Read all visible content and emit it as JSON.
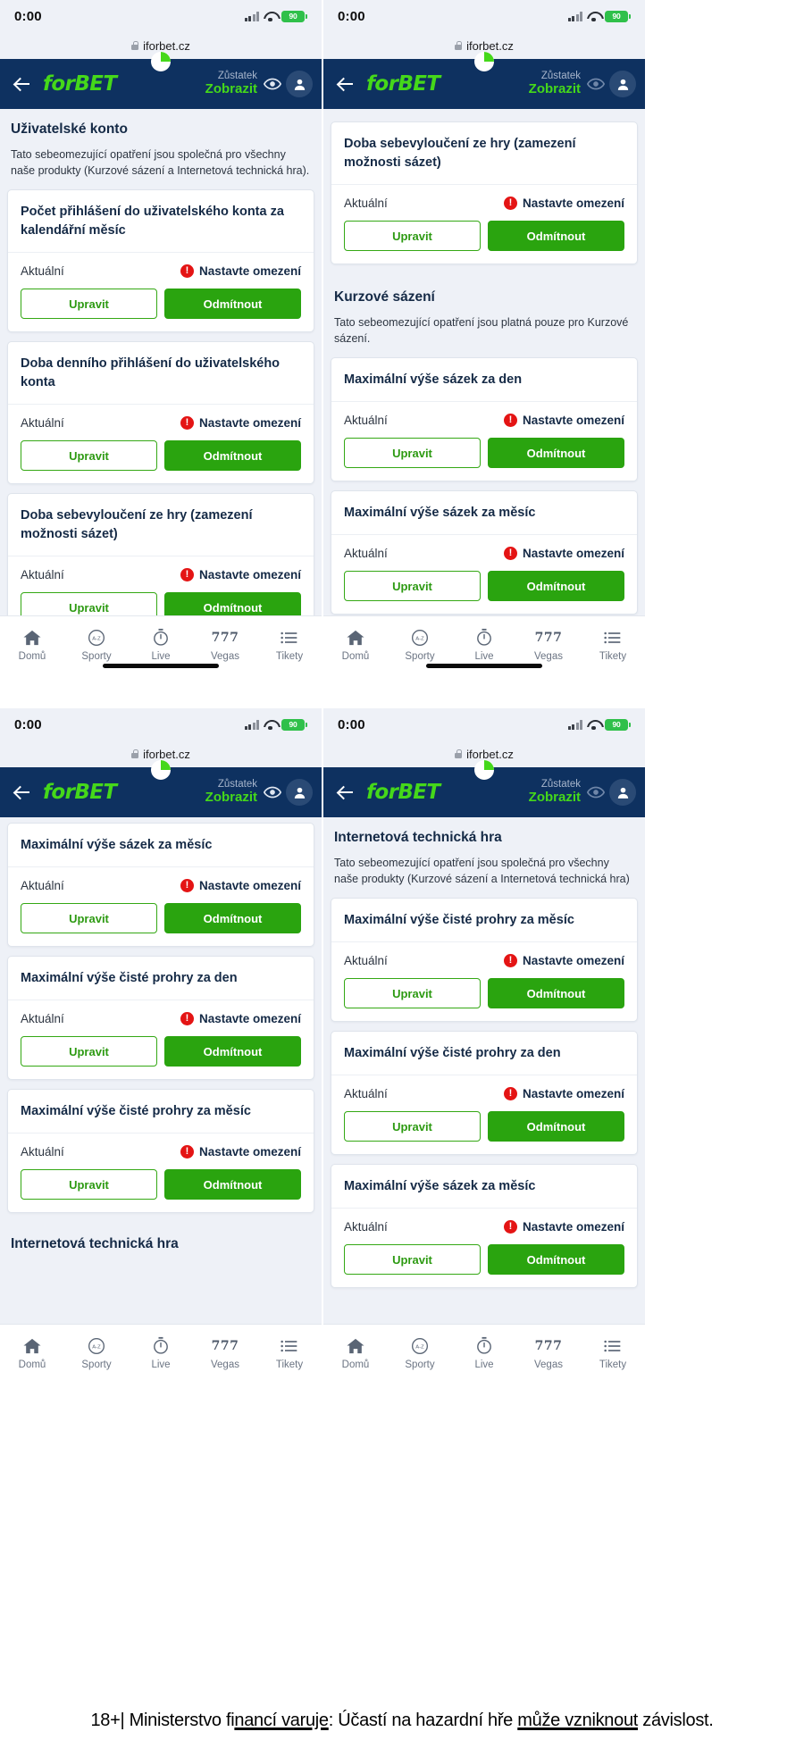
{
  "status_bar": {
    "time": "0:00",
    "battery": "90",
    "signal_icon": "cellular-bars-icon",
    "wifi_icon": "wifi-icon"
  },
  "browser": {
    "lock_icon": "lock-icon",
    "url": "iforbet.cz"
  },
  "appbar": {
    "back_icon": "back-arrow-icon",
    "logo": "forBET",
    "balance_label": "Zůstatek",
    "balance_value": "Zobrazit",
    "eye_icon": "eye-icon",
    "avatar_icon": "user-avatar-icon"
  },
  "labels": {
    "current": "Aktuální",
    "set_limit": "Nastavte omezení",
    "edit": "Upravit",
    "decline": "Odmítnout",
    "warning_icon": "warning-exclamation-icon"
  },
  "sections": {
    "user_account": {
      "title": "Uživatelské konto",
      "desc": "Tato sebeomezující opatření jsou společná pro všechny naše produkty (Kurzové sázení a Internetová technická hra)."
    },
    "odds_betting": {
      "title": "Kurzové sázení",
      "desc": "Tato sebeomezující opatření jsou platná pouze pro Kurzové sázení."
    },
    "tech_game": {
      "title": "Internetová technická hra",
      "desc": "Tato sebeomezující opatření jsou společná pro všechny naše produkty (Kurzové sázení a Internetová technická hra)"
    }
  },
  "limits": {
    "login_count_month": "Počet přihlášení do uživatelského konta za kalendářní měsíc",
    "login_duration_day": "Doba denního přihlášení do uživatelského konta",
    "self_exclusion": "Doba sebevyloučení ze hry (zamezení možnosti sázet)",
    "max_stake_day": "Maximální výše sázek za den",
    "max_stake_month": "Maximální výše sázek za měsíc",
    "max_net_loss_day": "Maximální výše čisté prohry za den",
    "max_net_loss_month": "Maximální výše čisté prohry za měsíc"
  },
  "tabbar": {
    "items": [
      {
        "label": "Domů",
        "icon": "home-icon"
      },
      {
        "label": "Sporty",
        "icon": "sports-az-icon"
      },
      {
        "label": "Live",
        "icon": "stopwatch-icon"
      },
      {
        "label": "Vegas",
        "icon": "777-icon",
        "text_icon": "777"
      },
      {
        "label": "Tikety",
        "icon": "list-icon"
      }
    ]
  },
  "legal": {
    "prefix": "18+| Ministerstvo fi",
    "u1": "nancí varuje",
    "mid": ": Účastí na hazardní hře ",
    "u2": "může vzniknout",
    "suffix": " závislost."
  },
  "colors": {
    "brand_green": "#45d81a",
    "button_green": "#2aa40f",
    "header_navy": "#0e3160",
    "warning_red": "#e41414",
    "page_bg": "#eef1f7"
  }
}
